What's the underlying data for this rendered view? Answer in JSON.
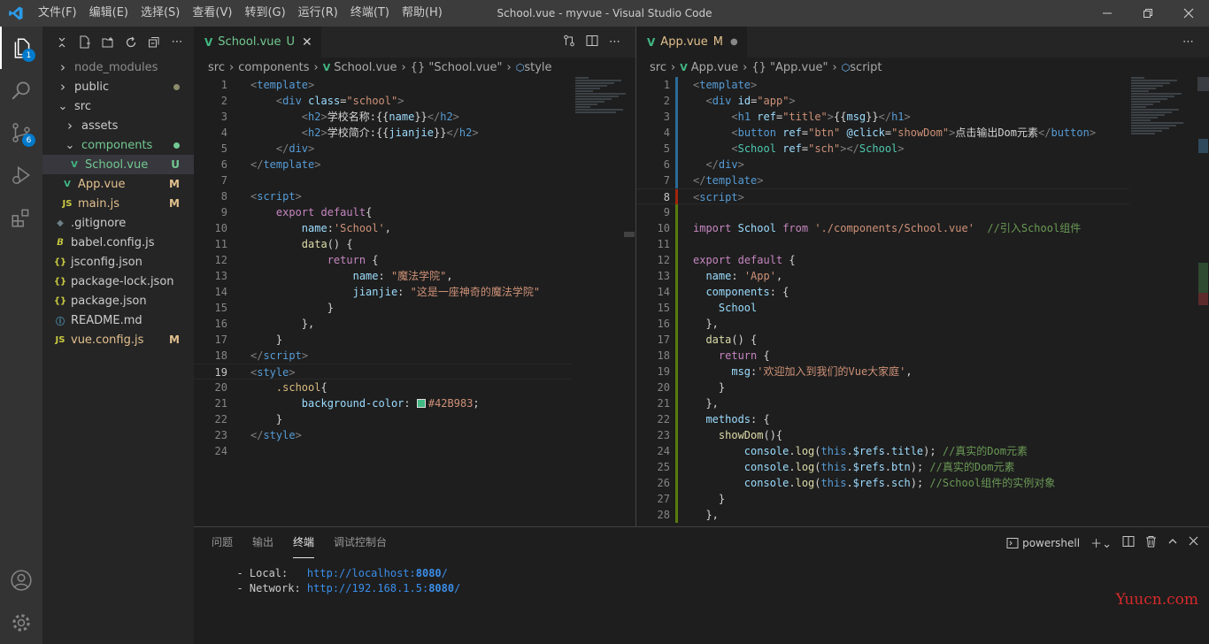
{
  "titlebar": {
    "menus": [
      "文件(F)",
      "编辑(E)",
      "选择(S)",
      "查看(V)",
      "转到(G)",
      "运行(R)",
      "终端(T)",
      "帮助(H)"
    ],
    "window_title": "School.vue - myvue - Visual Studio Code"
  },
  "activity": {
    "explorer_badge": "1",
    "scm_badge": "6"
  },
  "explorer": {
    "items": [
      {
        "label": "node_modules",
        "kind": "folder",
        "expanded": false,
        "indent": 0,
        "color": "#8c8c8c"
      },
      {
        "label": "public",
        "kind": "folder",
        "expanded": false,
        "indent": 0,
        "color": "#cccccc",
        "dot": "#8b8b6b"
      },
      {
        "label": "src",
        "kind": "folder",
        "expanded": true,
        "indent": 0,
        "color": "#cccccc"
      },
      {
        "label": "assets",
        "kind": "folder",
        "expanded": false,
        "indent": 1,
        "color": "#cccccc"
      },
      {
        "label": "components",
        "kind": "folder",
        "expanded": true,
        "indent": 1,
        "color": "#73c991",
        "dot": "#73c991"
      },
      {
        "label": "School.vue",
        "kind": "vue",
        "indent": 2,
        "color": "#73c991",
        "deco": "U",
        "deco_color": "#73c991",
        "selected": true
      },
      {
        "label": "App.vue",
        "kind": "vue",
        "indent": 1,
        "color": "#e2c08d",
        "deco": "M",
        "deco_color": "#e2c08d"
      },
      {
        "label": "main.js",
        "kind": "js",
        "indent": 1,
        "color": "#e2c08d",
        "deco": "M",
        "deco_color": "#e2c08d"
      },
      {
        "label": ".gitignore",
        "kind": "git",
        "indent": 0,
        "color": "#cccccc"
      },
      {
        "label": "babel.config.js",
        "kind": "babel",
        "indent": 0,
        "color": "#cccccc"
      },
      {
        "label": "jsconfig.json",
        "kind": "json",
        "indent": 0,
        "color": "#cccccc"
      },
      {
        "label": "package-lock.json",
        "kind": "json",
        "indent": 0,
        "color": "#cccccc"
      },
      {
        "label": "package.json",
        "kind": "json",
        "indent": 0,
        "color": "#cccccc"
      },
      {
        "label": "README.md",
        "kind": "info",
        "indent": 0,
        "color": "#cccccc"
      },
      {
        "label": "vue.config.js",
        "kind": "js",
        "indent": 0,
        "color": "#e2c08d",
        "deco": "M",
        "deco_color": "#e2c08d"
      }
    ]
  },
  "left_editor": {
    "tab_name": "School.vue",
    "tab_status": "U",
    "breadcrumb": [
      "src",
      "components",
      "School.vue",
      "{} \"School.vue\"",
      "style"
    ],
    "current_line": 19,
    "lines": [
      [
        [
          "br",
          "<"
        ],
        [
          "tag",
          "template"
        ],
        [
          "br",
          ">"
        ]
      ],
      [
        [
          "txt",
          "    "
        ],
        [
          "br",
          "<"
        ],
        [
          "tag",
          "div"
        ],
        [
          "txt",
          " "
        ],
        [
          "attr",
          "class"
        ],
        [
          "txt",
          "="
        ],
        [
          "str",
          "\"school\""
        ],
        [
          "br",
          ">"
        ]
      ],
      [
        [
          "txt",
          "        "
        ],
        [
          "br",
          "<"
        ],
        [
          "tag",
          "h2"
        ],
        [
          "br",
          ">"
        ],
        [
          "txt",
          "学校名称:{{"
        ],
        [
          "var",
          "name"
        ],
        [
          "txt",
          "}}"
        ],
        [
          "br",
          "</"
        ],
        [
          "tag",
          "h2"
        ],
        [
          "br",
          ">"
        ]
      ],
      [
        [
          "txt",
          "        "
        ],
        [
          "br",
          "<"
        ],
        [
          "tag",
          "h2"
        ],
        [
          "br",
          ">"
        ],
        [
          "txt",
          "学校简介:{{"
        ],
        [
          "var",
          "jianjie"
        ],
        [
          "txt",
          "}}"
        ],
        [
          "br",
          "</"
        ],
        [
          "tag",
          "h2"
        ],
        [
          "br",
          ">"
        ]
      ],
      [
        [
          "txt",
          "    "
        ],
        [
          "br",
          "</"
        ],
        [
          "tag",
          "div"
        ],
        [
          "br",
          ">"
        ]
      ],
      [
        [
          "br",
          "</"
        ],
        [
          "tag",
          "template"
        ],
        [
          "br",
          ">"
        ]
      ],
      [],
      [
        [
          "br",
          "<"
        ],
        [
          "tag",
          "script"
        ],
        [
          "br",
          ">"
        ]
      ],
      [
        [
          "txt",
          "    "
        ],
        [
          "kw",
          "export"
        ],
        [
          "txt",
          " "
        ],
        [
          "kw",
          "default"
        ],
        [
          "txt",
          "{"
        ]
      ],
      [
        [
          "txt",
          "        "
        ],
        [
          "var",
          "name"
        ],
        [
          "txt",
          ":"
        ],
        [
          "str",
          "'School'"
        ],
        [
          "txt",
          ","
        ]
      ],
      [
        [
          "txt",
          "        "
        ],
        [
          "fn",
          "data"
        ],
        [
          "txt",
          "() {"
        ]
      ],
      [
        [
          "txt",
          "            "
        ],
        [
          "kw",
          "return"
        ],
        [
          "txt",
          " {"
        ]
      ],
      [
        [
          "txt",
          "                "
        ],
        [
          "var",
          "name"
        ],
        [
          "txt",
          ": "
        ],
        [
          "str",
          "\"魔法学院\""
        ],
        [
          "txt",
          ","
        ]
      ],
      [
        [
          "txt",
          "                "
        ],
        [
          "var",
          "jianjie"
        ],
        [
          "txt",
          ": "
        ],
        [
          "str",
          "\"这是一座神奇的魔法学院\""
        ]
      ],
      [
        [
          "txt",
          "            }"
        ]
      ],
      [
        [
          "txt",
          "        },"
        ]
      ],
      [
        [
          "txt",
          "    }"
        ]
      ],
      [
        [
          "br",
          "</"
        ],
        [
          "tag",
          "script"
        ],
        [
          "br",
          ">"
        ]
      ],
      [
        [
          "br",
          "<"
        ],
        [
          "tag",
          "style"
        ],
        [
          "br",
          ">"
        ]
      ],
      [
        [
          "txt",
          "    "
        ],
        [
          "cls",
          ".school"
        ],
        [
          "txt",
          "{"
        ]
      ],
      [
        [
          "txt",
          "        "
        ],
        [
          "var",
          "background-color"
        ],
        [
          "txt",
          ": "
        ],
        [
          "swatch",
          "#42B983"
        ],
        [
          "str",
          "#42B983"
        ],
        [
          "txt",
          ";"
        ]
      ],
      [
        [
          "txt",
          "    }"
        ]
      ],
      [
        [
          "br",
          "</"
        ],
        [
          "tag",
          "style"
        ],
        [
          "br",
          ">"
        ]
      ],
      []
    ]
  },
  "right_editor": {
    "tab_name": "App.vue",
    "tab_status": "M",
    "breadcrumb": [
      "src",
      "App.vue",
      "{} \"App.vue\"",
      "script"
    ],
    "current_line": 8,
    "lines": [
      [
        [
          "br",
          "<"
        ],
        [
          "tag",
          "template"
        ],
        [
          "br",
          ">"
        ]
      ],
      [
        [
          "txt",
          "  "
        ],
        [
          "br",
          "<"
        ],
        [
          "tag",
          "div"
        ],
        [
          "txt",
          " "
        ],
        [
          "attr",
          "id"
        ],
        [
          "txt",
          "="
        ],
        [
          "str",
          "\"app\""
        ],
        [
          "br",
          ">"
        ]
      ],
      [
        [
          "txt",
          "      "
        ],
        [
          "br",
          "<"
        ],
        [
          "tag",
          "h1"
        ],
        [
          "txt",
          " "
        ],
        [
          "attr",
          "ref"
        ],
        [
          "txt",
          "="
        ],
        [
          "str",
          "\"title\""
        ],
        [
          "br",
          ">"
        ],
        [
          "txt",
          "{{"
        ],
        [
          "var",
          "msg"
        ],
        [
          "txt",
          "}}"
        ],
        [
          "br",
          "</"
        ],
        [
          "tag",
          "h1"
        ],
        [
          "br",
          ">"
        ]
      ],
      [
        [
          "txt",
          "      "
        ],
        [
          "br",
          "<"
        ],
        [
          "tag",
          "button"
        ],
        [
          "txt",
          " "
        ],
        [
          "attr",
          "ref"
        ],
        [
          "txt",
          "="
        ],
        [
          "str",
          "\"btn\""
        ],
        [
          "txt",
          " "
        ],
        [
          "attr",
          "@click"
        ],
        [
          "txt",
          "="
        ],
        [
          "str",
          "\"showDom\""
        ],
        [
          "br",
          ">"
        ],
        [
          "txt",
          "点击输出Dom元素"
        ],
        [
          "br",
          "</"
        ],
        [
          "tag",
          "button"
        ],
        [
          "br",
          ">"
        ]
      ],
      [
        [
          "txt",
          "      "
        ],
        [
          "br",
          "<"
        ],
        [
          "comp",
          "School"
        ],
        [
          "txt",
          " "
        ],
        [
          "attr",
          "ref"
        ],
        [
          "txt",
          "="
        ],
        [
          "str",
          "\"sch\""
        ],
        [
          "br",
          "></"
        ],
        [
          "comp",
          "School"
        ],
        [
          "br",
          ">"
        ]
      ],
      [
        [
          "txt",
          "  "
        ],
        [
          "br",
          "</"
        ],
        [
          "tag",
          "div"
        ],
        [
          "br",
          ">"
        ]
      ],
      [
        [
          "br",
          "</"
        ],
        [
          "tag",
          "template"
        ],
        [
          "br",
          ">"
        ]
      ],
      [
        [
          "br",
          "<"
        ],
        [
          "tag",
          "script"
        ],
        [
          "br",
          ">"
        ]
      ],
      [],
      [
        [
          "kw",
          "import"
        ],
        [
          "txt",
          " "
        ],
        [
          "var",
          "School"
        ],
        [
          "txt",
          " "
        ],
        [
          "kw",
          "from"
        ],
        [
          "txt",
          " "
        ],
        [
          "str",
          "'./components/School.vue'"
        ],
        [
          "txt",
          "  "
        ],
        [
          "cmt",
          "//引入School组件"
        ]
      ],
      [],
      [
        [
          "kw",
          "export"
        ],
        [
          "txt",
          " "
        ],
        [
          "kw",
          "default"
        ],
        [
          "txt",
          " {"
        ]
      ],
      [
        [
          "txt",
          "  "
        ],
        [
          "var",
          "name"
        ],
        [
          "txt",
          ": "
        ],
        [
          "str",
          "'App'"
        ],
        [
          "txt",
          ","
        ]
      ],
      [
        [
          "txt",
          "  "
        ],
        [
          "var",
          "components"
        ],
        [
          "txt",
          ": {"
        ]
      ],
      [
        [
          "txt",
          "    "
        ],
        [
          "var",
          "School"
        ]
      ],
      [
        [
          "txt",
          "  },"
        ]
      ],
      [
        [
          "txt",
          "  "
        ],
        [
          "fn",
          "data"
        ],
        [
          "txt",
          "() {"
        ]
      ],
      [
        [
          "txt",
          "    "
        ],
        [
          "kw",
          "return"
        ],
        [
          "txt",
          " {"
        ]
      ],
      [
        [
          "txt",
          "      "
        ],
        [
          "var",
          "msg"
        ],
        [
          "txt",
          ":"
        ],
        [
          "str",
          "'欢迎加入到我们的Vue大家庭'"
        ],
        [
          "txt",
          ","
        ]
      ],
      [
        [
          "txt",
          "    }"
        ]
      ],
      [
        [
          "txt",
          "  },"
        ]
      ],
      [
        [
          "txt",
          "  "
        ],
        [
          "var",
          "methods"
        ],
        [
          "txt",
          ": {"
        ]
      ],
      [
        [
          "txt",
          "    "
        ],
        [
          "fn",
          "showDom"
        ],
        [
          "txt",
          "(){"
        ]
      ],
      [
        [
          "txt",
          "        "
        ],
        [
          "var",
          "console"
        ],
        [
          "txt",
          "."
        ],
        [
          "fn",
          "log"
        ],
        [
          "txt",
          "("
        ],
        [
          "this",
          "this"
        ],
        [
          "txt",
          "."
        ],
        [
          "var",
          "$refs"
        ],
        [
          "txt",
          "."
        ],
        [
          "var",
          "title"
        ],
        [
          "txt",
          "); "
        ],
        [
          "cmt",
          "//真实的Dom元素"
        ]
      ],
      [
        [
          "txt",
          "        "
        ],
        [
          "var",
          "console"
        ],
        [
          "txt",
          "."
        ],
        [
          "fn",
          "log"
        ],
        [
          "txt",
          "("
        ],
        [
          "this",
          "this"
        ],
        [
          "txt",
          "."
        ],
        [
          "var",
          "$refs"
        ],
        [
          "txt",
          "."
        ],
        [
          "var",
          "btn"
        ],
        [
          "txt",
          "); "
        ],
        [
          "cmt",
          "//真实的Dom元素"
        ]
      ],
      [
        [
          "txt",
          "        "
        ],
        [
          "var",
          "console"
        ],
        [
          "txt",
          "."
        ],
        [
          "fn",
          "log"
        ],
        [
          "txt",
          "("
        ],
        [
          "this",
          "this"
        ],
        [
          "txt",
          "."
        ],
        [
          "var",
          "$refs"
        ],
        [
          "txt",
          "."
        ],
        [
          "var",
          "sch"
        ],
        [
          "txt",
          "); "
        ],
        [
          "cmt",
          "//School组件的实例对象"
        ]
      ],
      [
        [
          "txt",
          "    }"
        ]
      ],
      [
        [
          "txt",
          "  },"
        ]
      ]
    ]
  },
  "panel": {
    "tabs": [
      "问题",
      "输出",
      "终端",
      "调试控制台"
    ],
    "active_tab": "终端",
    "shell": "powershell",
    "terminal": {
      "local_label": "  - Local:   ",
      "local_url": "http://localhost:",
      "local_port": "8080",
      "network_label": "  - Network: ",
      "network_url": "http://192.168.1.5:",
      "network_port": "8080",
      "slash": "/"
    }
  },
  "watermark": "Yuucn.com",
  "colors": {
    "accent": "#007acc",
    "added": "#73c991",
    "modified": "#e2c08d",
    "vue": "#41b883"
  }
}
